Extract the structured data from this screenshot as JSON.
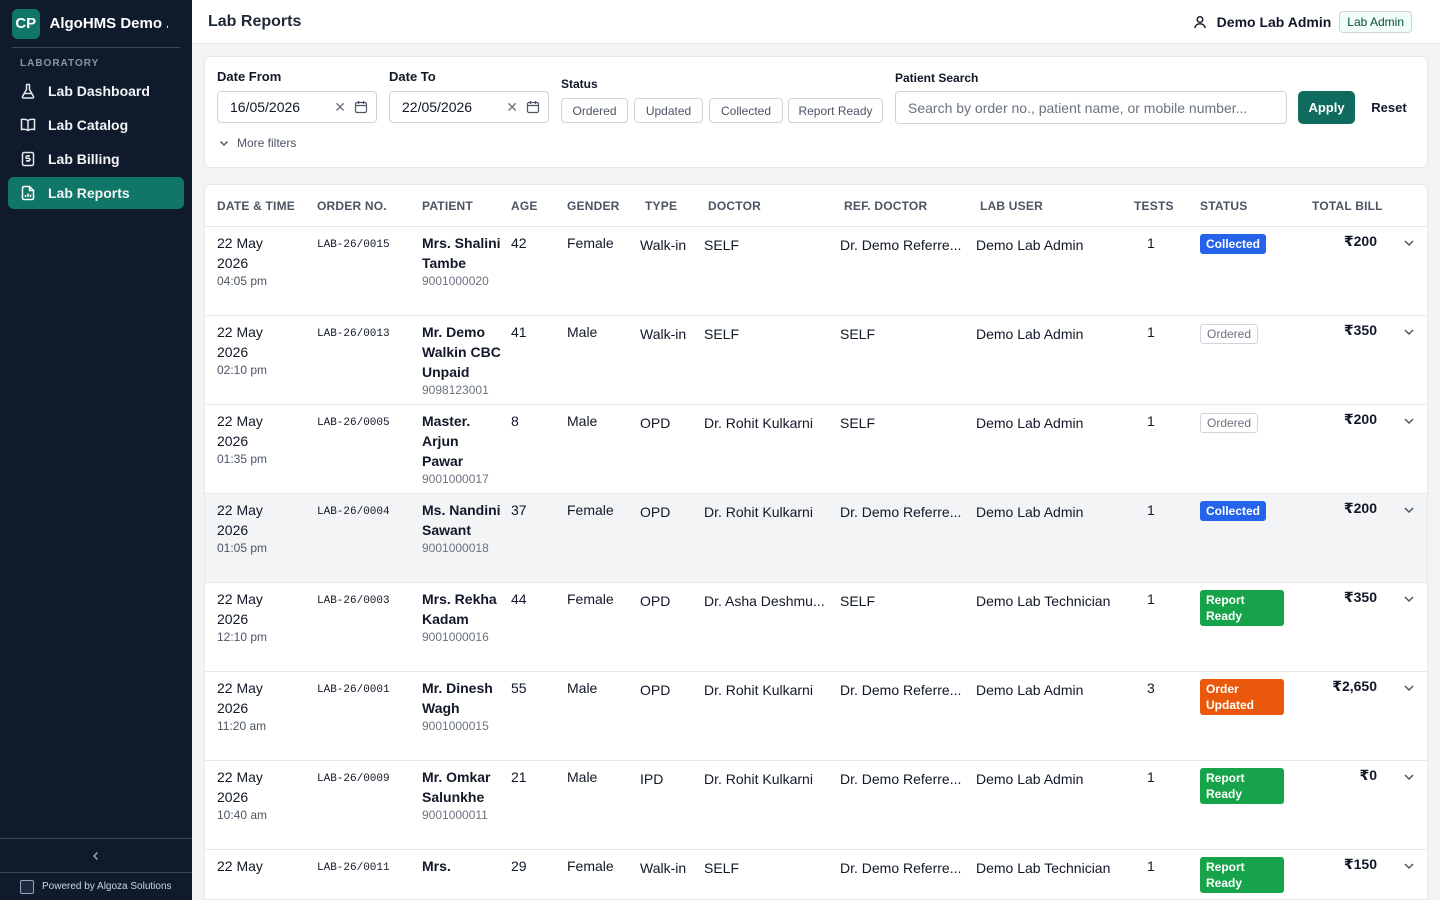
{
  "app": {
    "logo": "CP",
    "name": "AlgoHMS Demo ..."
  },
  "sidebar": {
    "section": "LABORATORY",
    "items": [
      {
        "label": "Lab Dashboard",
        "icon": "flask-icon"
      },
      {
        "label": "Lab Catalog",
        "icon": "book-icon"
      },
      {
        "label": "Lab Billing",
        "icon": "billing-icon"
      },
      {
        "label": "Lab Reports",
        "icon": "report-icon",
        "active": true
      }
    ],
    "powered_by": "Powered by Algoza Solutions"
  },
  "header": {
    "title": "Lab Reports",
    "user_name": "Demo Lab Admin",
    "role": "Lab Admin"
  },
  "filters": {
    "date_from_label": "Date From",
    "date_from": "16/05/2026",
    "date_to_label": "Date To",
    "date_to": "22/05/2026",
    "status_label": "Status",
    "statuses": [
      "Ordered",
      "Updated",
      "Collected",
      "Report Ready"
    ],
    "search_label": "Patient Search",
    "search_placeholder": "Search by order no., patient name, or mobile number...",
    "apply": "Apply",
    "reset": "Reset",
    "more_filters": "More filters"
  },
  "table": {
    "columns": [
      "DATE & TIME",
      "ORDER NO.",
      "PATIENT",
      "AGE",
      "GENDER",
      "TYPE",
      "DOCTOR",
      "REF. DOCTOR",
      "LAB USER",
      "TESTS",
      "STATUS",
      "TOTAL BILL"
    ],
    "rows": [
      {
        "date": "22 May 2026",
        "time": "04:05 pm",
        "order": "LAB-26/0015",
        "patient": "Mrs. Shalini Tambe",
        "mobile": "9001000020",
        "age": "42",
        "gender": "Female",
        "type": "Walk-in",
        "doctor": "SELF",
        "ref": "Dr. Demo Referre...",
        "user": "Demo Lab Admin",
        "tests": "1",
        "status": "Collected",
        "bill": "₹200"
      },
      {
        "date": "22 May 2026",
        "time": "02:10 pm",
        "order": "LAB-26/0013",
        "patient": "Mr. Demo Walkin CBC Unpaid",
        "mobile": "9098123001",
        "age": "41",
        "gender": "Male",
        "type": "Walk-in",
        "doctor": "SELF",
        "ref": "SELF",
        "user": "Demo Lab Admin",
        "tests": "1",
        "status": "Ordered",
        "bill": "₹350"
      },
      {
        "date": "22 May 2026",
        "time": "01:35 pm",
        "order": "LAB-26/0005",
        "patient": "Master. Arjun Pawar",
        "mobile": "9001000017",
        "age": "8",
        "gender": "Male",
        "type": "OPD",
        "doctor": "Dr. Rohit Kulkarni",
        "ref": "SELF",
        "user": "Demo Lab Admin",
        "tests": "1",
        "status": "Ordered",
        "bill": "₹200"
      },
      {
        "date": "22 May 2026",
        "time": "01:05 pm",
        "order": "LAB-26/0004",
        "patient": "Ms. Nandini Sawant",
        "mobile": "9001000018",
        "age": "37",
        "gender": "Female",
        "type": "OPD",
        "doctor": "Dr. Rohit Kulkarni",
        "ref": "Dr. Demo Referre...",
        "user": "Demo Lab Admin",
        "tests": "1",
        "status": "Collected",
        "bill": "₹200"
      },
      {
        "date": "22 May 2026",
        "time": "12:10 pm",
        "order": "LAB-26/0003",
        "patient": "Mrs. Rekha Kadam",
        "mobile": "9001000016",
        "age": "44",
        "gender": "Female",
        "type": "OPD",
        "doctor": "Dr. Asha Deshmu...",
        "ref": "SELF",
        "user": "Demo Lab Technician",
        "tests": "1",
        "status": "Report Ready",
        "bill": "₹350"
      },
      {
        "date": "22 May 2026",
        "time": "11:20 am",
        "order": "LAB-26/0001",
        "patient": "Mr. Dinesh Wagh",
        "mobile": "9001000015",
        "age": "55",
        "gender": "Male",
        "type": "OPD",
        "doctor": "Dr. Rohit Kulkarni",
        "ref": "Dr. Demo Referre...",
        "user": "Demo Lab Admin",
        "tests": "3",
        "status": "Order Updated",
        "bill": "₹2,650"
      },
      {
        "date": "22 May 2026",
        "time": "10:40 am",
        "order": "LAB-26/0009",
        "patient": "Mr. Omkar Salunkhe",
        "mobile": "9001000011",
        "age": "21",
        "gender": "Male",
        "type": "IPD",
        "doctor": "Dr. Rohit Kulkarni",
        "ref": "Dr. Demo Referre...",
        "user": "Demo Lab Admin",
        "tests": "1",
        "status": "Report Ready",
        "bill": "₹0"
      },
      {
        "date": "22 May",
        "time": "",
        "order": "LAB-26/0011",
        "patient": "Mrs.",
        "mobile": "",
        "age": "29",
        "gender": "Female",
        "type": "Walk-in",
        "doctor": "SELF",
        "ref": "Dr. Demo Referre...",
        "user": "Demo Lab Technician",
        "tests": "1",
        "status": "Report Ready",
        "bill": "₹150"
      }
    ]
  },
  "colors": {
    "brand": "#107667",
    "sidebar_bg": "#0f1b2d",
    "collected": "#2563eb",
    "report_ready": "#16a34a",
    "order_updated": "#ea580c"
  }
}
